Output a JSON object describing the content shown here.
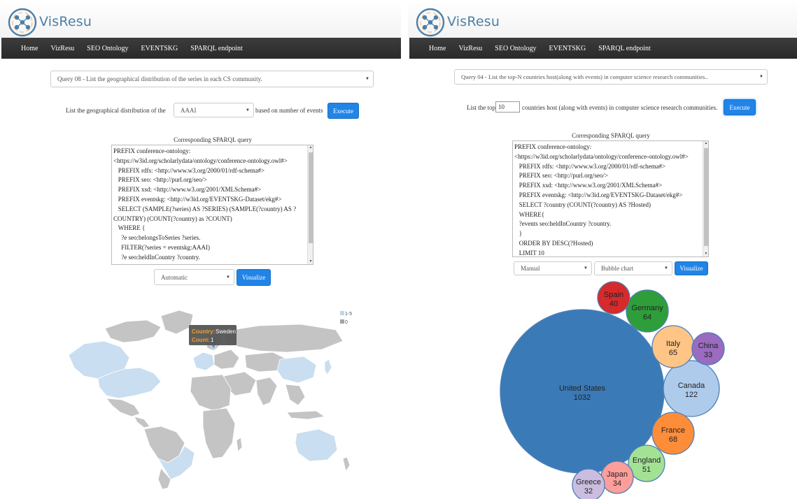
{
  "left": {
    "brand": {
      "logo_text": "VisResu"
    },
    "nav": [
      "Home",
      "VizResu",
      "SEO Ontology",
      "EVENTSKG",
      "SPARQL endpoint"
    ],
    "query_select": {
      "value": "Query 08 - List the geographical distribution of the series in each CS community."
    },
    "params": {
      "prefix_text": "List the geographical distribution of the",
      "series_value": "AAAI",
      "suffix_text": "based on number of events",
      "execute_label": "Execute"
    },
    "sparql": {
      "caption": "Corresponding SPARQL query",
      "lines": [
        "PREFIX conference-ontology:",
        "<https://w3id.org/scholarlydata/ontology/conference-ontology.owl#>",
        "   PREFIX rdfs: <http://www.w3.org/2000/01/rdf-schema#>",
        "   PREFIX seo: <http://purl.org/seo/>",
        "   PREFIX xsd: <http://www.w3.org/2001/XMLSchema#>",
        "   PREFIX eventskg: <http://w3id.org/EVENTSKG-Dataset/ekg#>",
        "   SELECT (SAMPLE(?series) AS ?SERIES) (SAMPLE(?country) AS ?COUNTRY) (COUNT(?country) as ?COUNT)",
        "   WHERE {",
        "     ?e seo:belongsToSeries ?series.",
        "     FILTER(?series = eventskg:AAAI)",
        "     ?e seo:heldInCountry ?country.",
        "  }"
      ]
    },
    "viz": {
      "mode_value": "Automatic",
      "visualize_label": "Visualize"
    },
    "map": {
      "legend": [
        {
          "label": "1-5",
          "color": "#bcd6ec"
        },
        {
          "label": "0",
          "color": "#a3a3a3"
        }
      ],
      "tooltip": {
        "country_key": "Country:",
        "country_value": "Sweden",
        "count_key": "Count:",
        "count_value": "1"
      },
      "colors": {
        "active": "#c9def0",
        "inactive": "#c4c4c4",
        "border": "#ffffff"
      }
    }
  },
  "right": {
    "brand": {
      "logo_text": "VisResu"
    },
    "nav": [
      "Home",
      "VizResu",
      "SEO Ontology",
      "EVENTSKG",
      "SPARQL endpoint"
    ],
    "query_select": {
      "value": "Query 04 - List the top-N countries host(along with events) in computer science research communities.."
    },
    "params": {
      "prefix_text": "List the top",
      "top_n_value": "10",
      "suffix_text": "countries host (along with events) in computer science research communities.",
      "execute_label": "Execute"
    },
    "sparql": {
      "caption": "Corresponding SPARQL query",
      "lines": [
        "PREFIX conference-ontology:",
        "<https://w3id.org/scholarlydata/ontology/conference-ontology.owl#>",
        "   PREFIX rdfs: <http://www.w3.org/2000/01/rdf-schema#>",
        "   PREFIX seo: <http://purl.org/seo/>",
        "   PREFIX xsd: <http://www.w3.org/2001/XMLSchema#>",
        "   PREFIX eventskg: <http://w3id.org/EVENTSKG-Dataset/ekg#>",
        "   SELECT ?country (COUNT(?country) AS ?Hosted)",
        "   WHERE{",
        "   ?events seo:heldInCountry ?country.",
        "   }",
        "   ORDER BY DESC(?Hosted)",
        "   LIMIT 10"
      ]
    },
    "viz": {
      "mode_value": "Manual",
      "chart_type_value": "Bubble chart",
      "visualize_label": "Visualize"
    }
  },
  "chart_data": {
    "type": "bubble",
    "title": "",
    "series": [
      {
        "label": "United States",
        "value": 1032,
        "color": "#3a7ab7"
      },
      {
        "label": "Canada",
        "value": 122,
        "color": "#aecbec"
      },
      {
        "label": "France",
        "value": 68,
        "color": "#fe8d3a"
      },
      {
        "label": "Italy",
        "value": 65,
        "color": "#fec586"
      },
      {
        "label": "Germany",
        "value": 64,
        "color": "#2e9e3a"
      },
      {
        "label": "England",
        "value": 51,
        "color": "#a3e295"
      },
      {
        "label": "Spain",
        "value": 40,
        "color": "#d62a2b"
      },
      {
        "label": "Japan",
        "value": 34,
        "color": "#fd9e9b"
      },
      {
        "label": "China",
        "value": 33,
        "color": "#9a6bc0"
      },
      {
        "label": "Greece",
        "value": 32,
        "color": "#cbbde0"
      }
    ]
  }
}
